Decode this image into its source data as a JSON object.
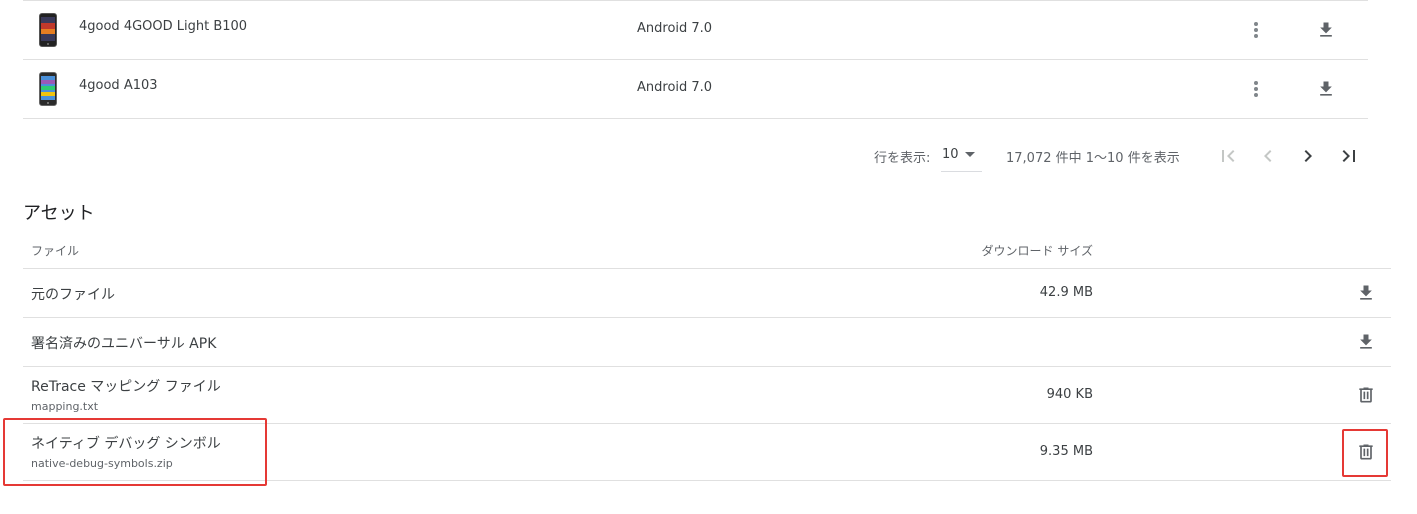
{
  "devices": [
    {
      "name": "4good 4GOOD Light B100",
      "os": "Android 7.0",
      "phone_icon": "phone-dark-icon"
    },
    {
      "name": "4good A103",
      "os": "Android 7.0",
      "phone_icon": "phone-colorful-icon"
    }
  ],
  "pagination": {
    "rows_label": "行を表示:",
    "rows_value": "10",
    "range_text": "17,072 件中 1～10 件を表示"
  },
  "assets": {
    "title": "アセット",
    "header": {
      "file": "ファイル",
      "size": "ダウンロード サイズ"
    },
    "rows": [
      {
        "name": "元のファイル",
        "sub": "",
        "size": "42.9 MB",
        "action_icon": "download-icon"
      },
      {
        "name": "署名済みのユニバーサル APK",
        "sub": "",
        "size": "",
        "action_icon": "download-icon"
      },
      {
        "name": "ReTrace マッピング ファイル",
        "sub": "mapping.txt",
        "size": "940 KB",
        "action_icon": "trash-icon"
      },
      {
        "name": "ネイティブ デバッグ シンボル",
        "sub": "native-debug-symbols.zip",
        "size": "9.35 MB",
        "action_icon": "trash-icon"
      }
    ]
  },
  "colors": {
    "highlight": "#e53935",
    "text": "#3c4043",
    "muted": "#5f6368",
    "divider": "#e0e0e0"
  }
}
